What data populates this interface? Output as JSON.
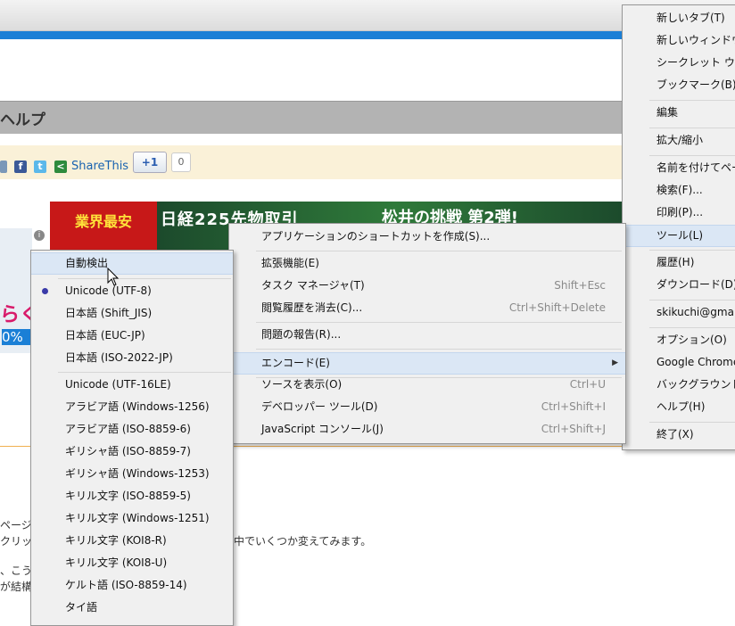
{
  "page": {
    "help_title": "ヘルプ",
    "share_label": "ShareThis",
    "plus_one": "+1",
    "plus_count": "0",
    "banner": {
      "badge": "業界最安",
      "headline": "日経225先物取引",
      "subhead": "松井の挑戦 第2弾!"
    },
    "thumb_text": "らく",
    "thumb_pct": "0%",
    "body_lines": [
      "ページが",
      "クリック",
      "中でいくつか変えてみます。",
      "、こうな",
      "が結構"
    ]
  },
  "main_menu": {
    "items": [
      {
        "label": "新しいタブ(T)"
      },
      {
        "label": "新しいウィンドウ"
      },
      {
        "label": "シークレット ウ"
      },
      {
        "label": "ブックマーク(B)"
      },
      {
        "label": "編集"
      },
      {
        "label": "拡大/縮小"
      },
      {
        "label": "名前を付けてペー"
      },
      {
        "label": "検索(F)..."
      },
      {
        "label": "印刷(P)..."
      },
      {
        "label": "ツール(L)"
      },
      {
        "label": "履歴(H)"
      },
      {
        "label": "ダウンロード(D)"
      },
      {
        "label": "skikuchi@gmai"
      },
      {
        "label": "オプション(O)"
      },
      {
        "label": "Google Chrome"
      },
      {
        "label": "バックグラウンド"
      },
      {
        "label": "ヘルプ(H)"
      },
      {
        "label": "終了(X)"
      }
    ]
  },
  "tools_menu": {
    "items": [
      {
        "label": "アプリケーションのショートカットを作成(S)...",
        "shortcut": ""
      },
      {
        "label": "拡張機能(E)",
        "shortcut": ""
      },
      {
        "label": "タスク マネージャ(T)",
        "shortcut": "Shift+Esc"
      },
      {
        "label": "閲覧履歴を消去(C)...",
        "shortcut": "Ctrl+Shift+Delete"
      },
      {
        "label": "問題の報告(R)...",
        "shortcut": ""
      },
      {
        "label": "エンコード(E)",
        "shortcut": ""
      },
      {
        "label": "ソースを表示(O)",
        "shortcut": "Ctrl+U"
      },
      {
        "label": "デベロッパー ツール(D)",
        "shortcut": "Ctrl+Shift+I"
      },
      {
        "label": "JavaScript コンソール(J)",
        "shortcut": "Ctrl+Shift+J"
      }
    ],
    "submenu_arrow": "▶"
  },
  "encoding_menu": {
    "items": [
      {
        "label": "自動検出"
      },
      {
        "label": "Unicode (UTF-8)"
      },
      {
        "label": "日本語 (Shift_JIS)"
      },
      {
        "label": "日本語 (EUC-JP)"
      },
      {
        "label": "日本語 (ISO-2022-JP)"
      },
      {
        "label": "Unicode (UTF-16LE)"
      },
      {
        "label": "アラビア語 (Windows-1256)"
      },
      {
        "label": "アラビア語 (ISO-8859-6)"
      },
      {
        "label": "ギリシャ語 (ISO-8859-7)"
      },
      {
        "label": "ギリシャ語 (Windows-1253)"
      },
      {
        "label": "キリル文字 (ISO-8859-5)"
      },
      {
        "label": "キリル文字 (Windows-1251)"
      },
      {
        "label": "キリル文字 (KOI8-R)"
      },
      {
        "label": "キリル文字 (KOI8-U)"
      },
      {
        "label": "ケルト語 (ISO-8859-14)"
      },
      {
        "label": "タイ語"
      }
    ],
    "selected": "Unicode (UTF-8)"
  },
  "colors": {
    "highlight": "#dbe7f5",
    "menu_bg": "#f0f0f0",
    "accent_blue": "#1a7fd6"
  }
}
